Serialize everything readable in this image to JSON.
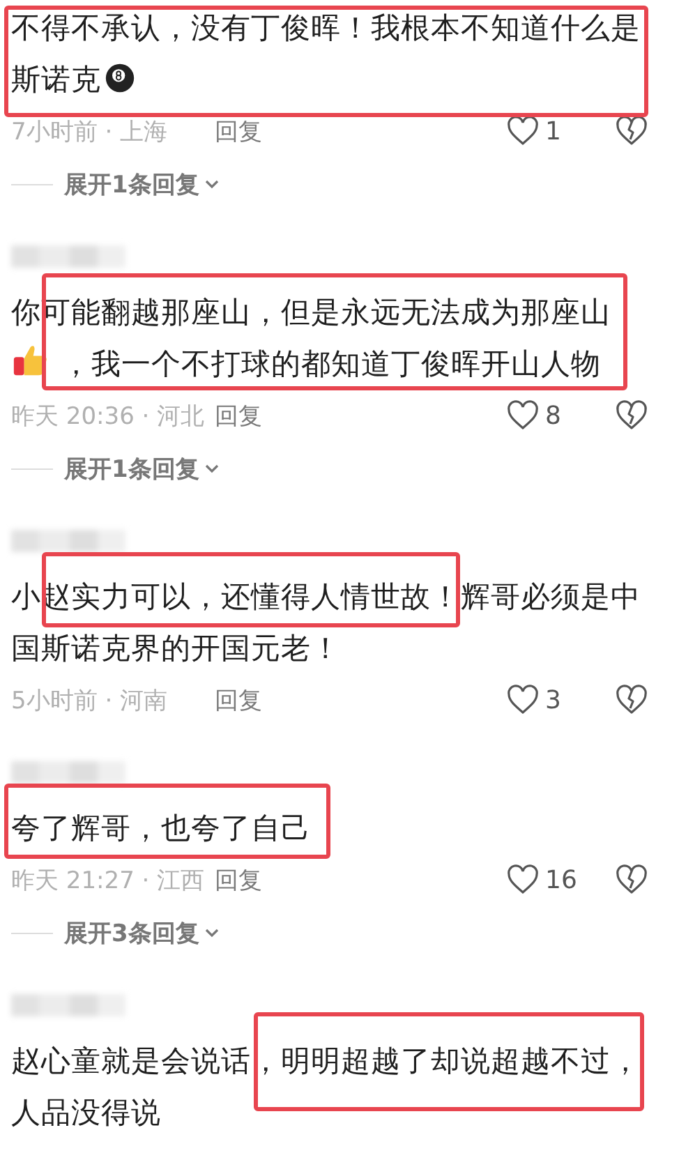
{
  "comments": [
    {
      "highlighted": true,
      "parts": [
        {
          "kind": "text",
          "text": "不得不承认，没有丁俊晖！我根本不知道什么是斯诺克"
        },
        {
          "kind": "eight-ball"
        }
      ],
      "time": "7小时前 · 上海",
      "reply": "回复",
      "likes": "1",
      "expand": "展开1条回复"
    },
    {
      "username": {
        "kind": "blurred"
      },
      "highlighted": true,
      "parts": [
        {
          "kind": "text",
          "text": "你可能翻越那座山，但是永远无法成为那座山"
        },
        {
          "kind": "thumbs-up"
        },
        {
          "kind": "text",
          "text": "，我一个不打球的都知道丁俊晖开山人物"
        }
      ],
      "time": "昨天 20:36 · 河北",
      "reply": "回复",
      "likes": "8",
      "expand": "展开1条回复"
    },
    {
      "username": {
        "kind": "blurred"
      },
      "highlighted": true,
      "parts": [
        {
          "kind": "text",
          "text": "小赵实力可以，还懂得人情世故！辉哥必须是中国斯诺克界的开国元老！"
        }
      ],
      "time": "5小时前 · 河南",
      "reply": "回复",
      "likes": "3"
    },
    {
      "username": {
        "kind": "blurred"
      },
      "highlighted": true,
      "parts": [
        {
          "kind": "text",
          "text": "夸了辉哥，也夸了自己"
        }
      ],
      "time": "昨天 21:27 · 江西",
      "reply": "回复",
      "likes": "16",
      "expand": "展开3条回复"
    },
    {
      "username": {
        "kind": "blurred"
      },
      "highlighted": true,
      "parts": [
        {
          "kind": "text",
          "text": "赵心童就是会说话，明明超越了却说超越不过，人品没得说"
        }
      ]
    }
  ]
}
